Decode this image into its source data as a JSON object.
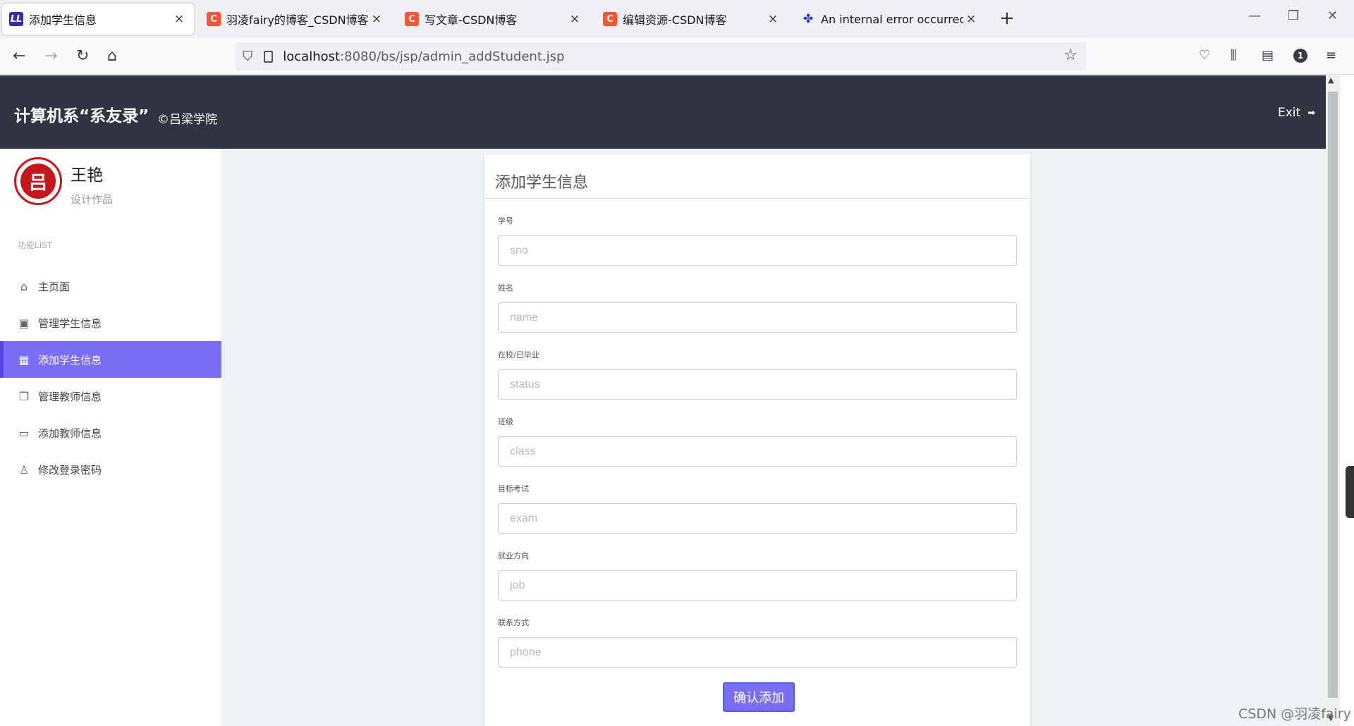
{
  "browser": {
    "tabs": [
      {
        "title": "添加学生信息",
        "icon": "ll-logo-icon"
      },
      {
        "title": "羽凌fairy的博客_CSDN博客-计",
        "icon": "csdn-icon"
      },
      {
        "title": "写文章-CSDN博客",
        "icon": "csdn-icon"
      },
      {
        "title": "编辑资源-CSDN博客",
        "icon": "csdn-icon"
      },
      {
        "title": "An internal error occurred du",
        "icon": "baidu-paw-icon"
      }
    ],
    "url_host": "localhost",
    "url_rest": ":8080/bs/jsp/admin_addStudent.jsp",
    "notification_count": "1"
  },
  "header": {
    "brand": "计算机系“系友录”",
    "brand_sub": "©吕梁学院",
    "exit_label": "Exit"
  },
  "sidebar": {
    "user_name": "王艳",
    "user_sub": "设计作品",
    "menu_caption": "功能LIST",
    "items": [
      {
        "label": "主页面",
        "icon": "home-icon"
      },
      {
        "label": "管理学生信息",
        "icon": "student-manage-icon"
      },
      {
        "label": "添加学生信息",
        "icon": "student-add-icon",
        "active": true
      },
      {
        "label": "管理教师信息",
        "icon": "teacher-manage-icon"
      },
      {
        "label": "添加教师信息",
        "icon": "teacher-add-icon"
      },
      {
        "label": "修改登录密码",
        "icon": "user-icon"
      }
    ]
  },
  "form": {
    "title": "添加学生信息",
    "fields": [
      {
        "label": "学号",
        "placeholder": "sno"
      },
      {
        "label": "姓名",
        "placeholder": "name"
      },
      {
        "label": "在校/已毕业",
        "placeholder": "status"
      },
      {
        "label": "班级",
        "placeholder": "class"
      },
      {
        "label": "目标考试",
        "placeholder": "exam"
      },
      {
        "label": "就业方向",
        "placeholder": "job"
      },
      {
        "label": "联系方式",
        "placeholder": "phone"
      }
    ],
    "submit_label": "确认添加"
  },
  "watermark": "CSDN @羽凌fairy",
  "colors": {
    "header_bg": "#2f3440",
    "accent": "#7b6ef6",
    "content_bg": "#edf2f5"
  }
}
